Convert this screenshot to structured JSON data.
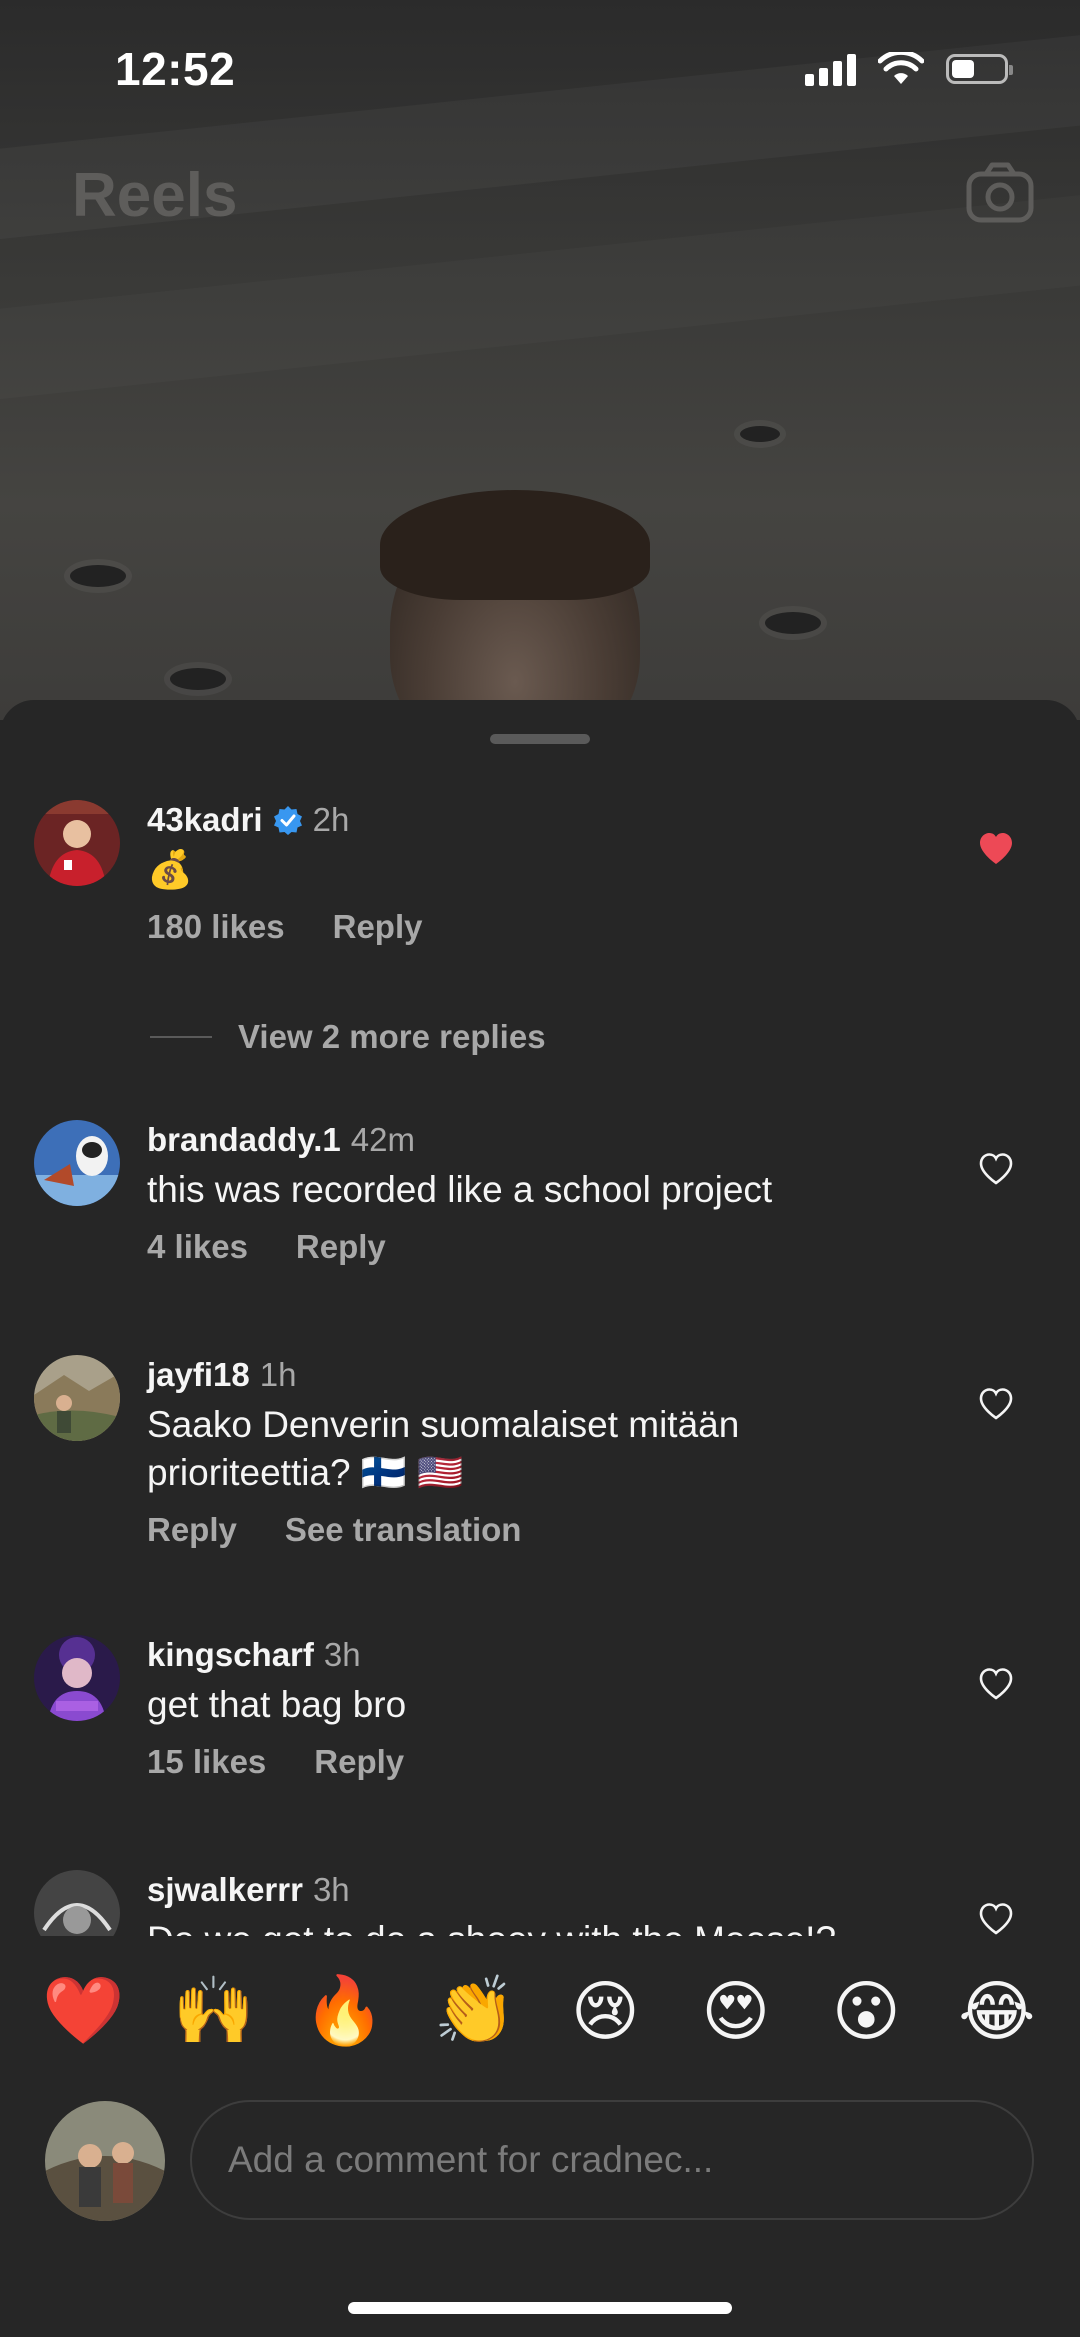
{
  "status_bar": {
    "time": "12:52"
  },
  "header": {
    "title": "Reels",
    "camera_icon": "camera-icon"
  },
  "comments": [
    {
      "username": "43kadri",
      "verified": true,
      "time": "2h",
      "text": "💰",
      "likes": "180 likes",
      "reply": "Reply",
      "liked": true
    },
    {
      "username": "brandaddy.1",
      "time": "42m",
      "text": "this was recorded like a school project",
      "likes": "4 likes",
      "reply": "Reply",
      "liked": false
    },
    {
      "username": "jayfi18",
      "time": "1h",
      "text": "Saako Denverin suomalaiset mitään prioriteettia? 🇫🇮 🇺🇸",
      "reply": "Reply",
      "translate": "See translation",
      "liked": false
    },
    {
      "username": "kingscharf",
      "time": "3h",
      "text": "get that bag bro",
      "likes": "15 likes",
      "reply": "Reply",
      "liked": false
    },
    {
      "username": "sjwalkerrr",
      "time": "3h",
      "text": "Do we get to do a shoey with the Moose!?",
      "liked": false
    }
  ],
  "view_more_replies": "View 2 more replies",
  "quick_reactions": [
    "❤️",
    "🙌",
    "🔥",
    "👏",
    "😢",
    "😍",
    "😮",
    "😂"
  ],
  "composer": {
    "placeholder": "Add a comment for cradnec..."
  },
  "colors": {
    "background": "#262626",
    "liked_heart": "#ed4956",
    "verified": "#3897f0",
    "muted_text": "#a8a8a8"
  }
}
